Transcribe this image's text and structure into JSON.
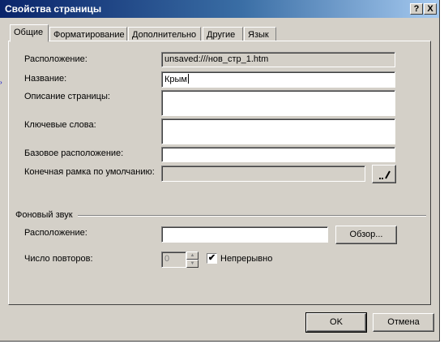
{
  "window": {
    "title": "Свойства страницы",
    "help_label": "?",
    "close_label": "X"
  },
  "tabs": [
    {
      "label": "Общие",
      "active": true
    },
    {
      "label": "Форматирование",
      "active": false
    },
    {
      "label": "Дополнительно",
      "active": false
    },
    {
      "label": "Другие",
      "active": false
    },
    {
      "label": "Язык",
      "active": false
    }
  ],
  "general": {
    "location_label": "Расположение:",
    "location_value": "unsaved:///нов_стр_1.htm",
    "title_label": "Название:",
    "title_value": "Крым",
    "description_label": "Описание страницы:",
    "description_value": "",
    "keywords_label": "Ключевые слова:",
    "keywords_value": "",
    "base_location_label": "Базовое расположение:",
    "base_location_value": "",
    "default_frame_label": "Конечная рамка по умолчанию:",
    "default_frame_value": "",
    "frame_edit_button_icon": "pencil-icon"
  },
  "background_sound": {
    "group_label": "Фоновый звук",
    "location_label": "Расположение:",
    "location_value": "",
    "browse_label": "Обзор...",
    "repeat_label": "Число повторов:",
    "repeat_value": "0",
    "continuous_label": "Непрерывно",
    "continuous_checked": true,
    "checkbox_mark": "✔"
  },
  "footer": {
    "ok_label": "OK",
    "cancel_label": "Отмена"
  },
  "colors": {
    "title_gradient_start": "#0a246a",
    "title_gradient_end": "#a6caf0",
    "dialog_face": "#d4d0c8"
  }
}
